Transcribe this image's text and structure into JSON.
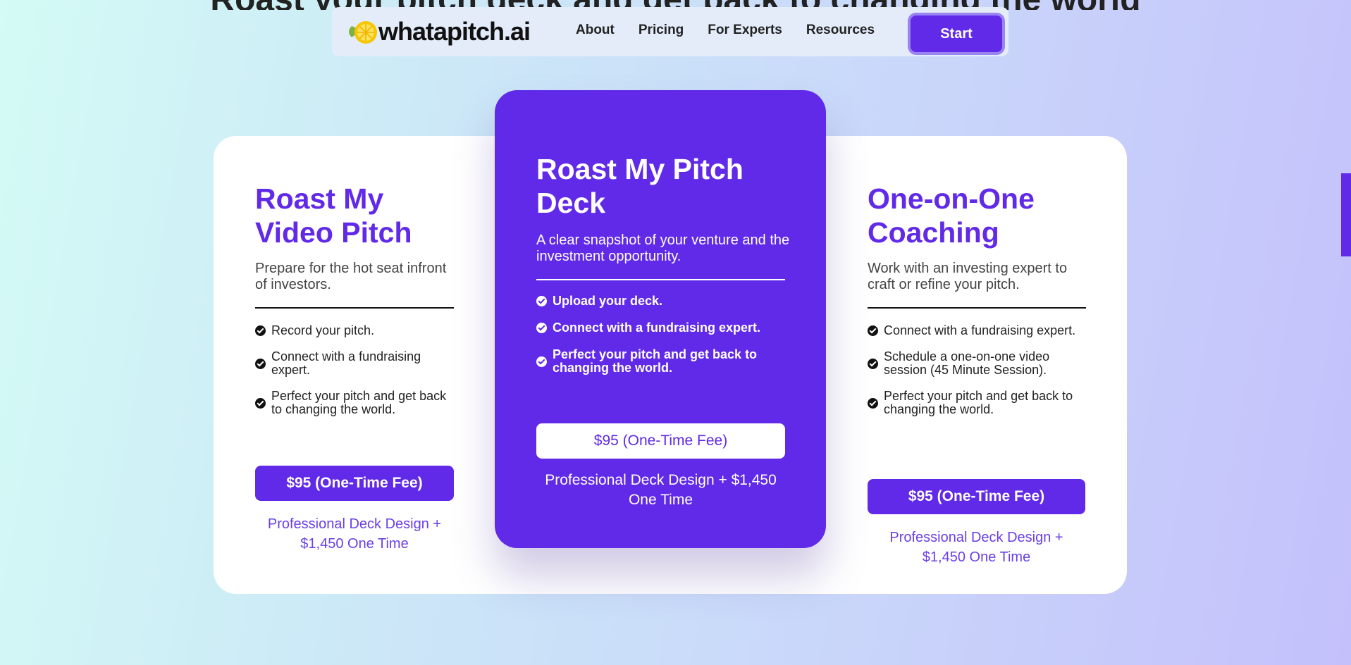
{
  "page": {
    "partial_heading": "Roast your pitch deck and get back to changing the world"
  },
  "nav": {
    "logo_text": "whatapitch.ai",
    "links": [
      "About",
      "Pricing",
      "For Experts",
      "Resources"
    ],
    "start_label": "Start"
  },
  "plans": [
    {
      "title": "Roast My Video Pitch",
      "subtitle": "Prepare for the hot seat infront of investors.",
      "features": [
        "Record your pitch.",
        "Connect with a fundraising expert.",
        "Perfect your pitch and get back to changing the world."
      ],
      "price_label": "$95 (One-Time Fee)",
      "pro_label": "Professional Deck Design + $1,450 One Time"
    },
    {
      "title": "Roast My Pitch Deck",
      "subtitle": "A clear snapshot of your venture and the investment opportunity.",
      "features": [
        "Upload your deck.",
        "Connect with a fundraising expert.",
        "Perfect your pitch and get back to changing the world."
      ],
      "price_label": "$95 (One-Time Fee)",
      "pro_label": "Professional Deck Design + $1,450 One Time"
    },
    {
      "title": "One-on-One Coaching",
      "subtitle": "Work with an investing expert to craft or refine your pitch.",
      "features": [
        "Connect with a fundraising expert.",
        "Schedule a one-on-one video session (45 Minute Session).",
        "Perfect your pitch and get back to changing the world."
      ],
      "price_label": "$95 (One-Time Fee)",
      "pro_label": "Professional Deck Design + $1,450 One Time"
    }
  ],
  "colors": {
    "accent": "#6129e8",
    "link": "#6a3fe6",
    "card_background": "#ffffff"
  },
  "icons": {
    "check": "check-circle-icon",
    "logo": "lemon-icon"
  }
}
